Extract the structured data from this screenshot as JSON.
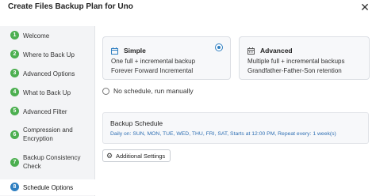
{
  "window": {
    "title": "Create Files Backup Plan for Uno",
    "close_icon": "close-icon"
  },
  "sidebar": {
    "steps": [
      {
        "num": "1",
        "label": "Welcome"
      },
      {
        "num": "2",
        "label": "Where to Back Up"
      },
      {
        "num": "3",
        "label": "Advanced Options"
      },
      {
        "num": "4",
        "label": "What to Back Up"
      },
      {
        "num": "5",
        "label": "Advanced Filter"
      },
      {
        "num": "6",
        "label_line1": "Compression and",
        "label_line2": "Encryption"
      },
      {
        "num": "7",
        "label_line1": "Backup Consistency",
        "label_line2": "Check"
      },
      {
        "num": "8",
        "label": "Schedule Options",
        "active": true
      }
    ]
  },
  "plans": {
    "simple": {
      "name": "Simple",
      "icon": "calendar-icon",
      "line1": "One full + incremental backup",
      "line2": "Forever Forward Incremental",
      "selected": true
    },
    "advanced": {
      "name": "Advanced",
      "icon": "calendar-grid-icon",
      "line1": "Multiple full + incremental backups",
      "line2": "Grandfather-Father-Son retention",
      "selected": false
    }
  },
  "no_schedule": {
    "label": "No schedule, run manually",
    "selected": false
  },
  "schedule": {
    "title": "Backup Schedule",
    "details": "Daily on: SUN, MON, TUE, WED, THU, FRI, SAT, Starts at 12:00 PM, Repeat every: 1 week(s)"
  },
  "additional_settings": {
    "label": "Additional Settings",
    "icon": "gear-icon"
  },
  "colors": {
    "step_done": "#4caf50",
    "step_active": "#2f7fc1",
    "link": "#2f6fb3"
  }
}
